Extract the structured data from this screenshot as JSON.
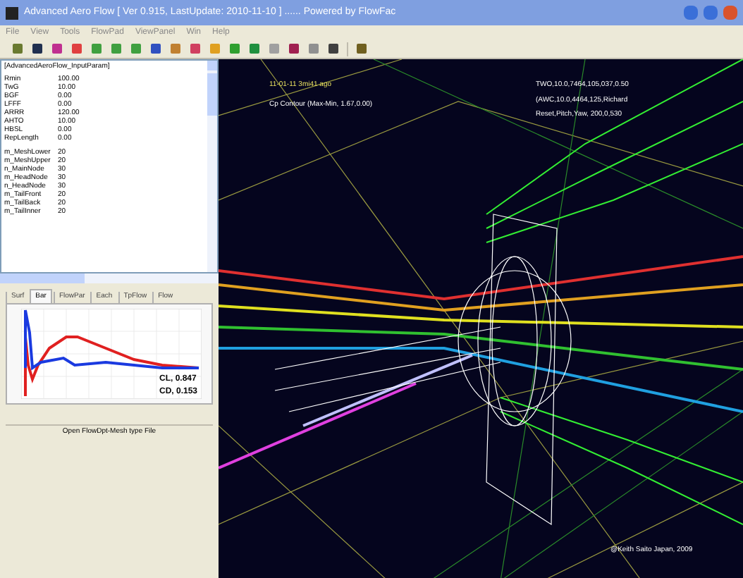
{
  "window": {
    "title": "Advanced Aero Flow [ Ver 0.915, LastUpdate: 2010-11-10 ] ...... Powered by FlowFac"
  },
  "menu": [
    "File",
    "View",
    "Tools",
    "FlowPad",
    "ViewPanel",
    "Win",
    "Help"
  ],
  "params": {
    "header": "[AdvancedAeroFlow_InputParam]",
    "groups": [
      [
        {
          "name": "Rmin",
          "value": "100.00"
        },
        {
          "name": "TwG",
          "value": "10.00"
        },
        {
          "name": "BGF",
          "value": "0.00"
        },
        {
          "name": "LFFF",
          "value": "0.00"
        },
        {
          "name": "ARRR",
          "value": "120.00"
        },
        {
          "name": "AHTO",
          "value": "10.00"
        },
        {
          "name": "HBSL",
          "value": "0.00"
        },
        {
          "name": "RepLength",
          "value": "0.00"
        }
      ],
      [
        {
          "name": "m_MeshLower",
          "value": "20"
        },
        {
          "name": "m_MeshUpper",
          "value": "20"
        },
        {
          "name": "n_MainNode",
          "value": "30"
        },
        {
          "name": "m_HeadNode",
          "value": "30"
        },
        {
          "name": "n_HeadNode",
          "value": "30"
        },
        {
          "name": "m_TailFront",
          "value": "20"
        },
        {
          "name": "m_TailBack",
          "value": "20"
        },
        {
          "name": "m_TailInner",
          "value": "20"
        }
      ]
    ]
  },
  "tabs": [
    {
      "label": "Surf",
      "selected": false
    },
    {
      "label": "Bar",
      "selected": true
    },
    {
      "label": "FlowPar",
      "selected": false
    },
    {
      "label": "Each",
      "selected": false
    },
    {
      "label": "TpFlow",
      "selected": false
    },
    {
      "label": "Flow",
      "selected": false
    }
  ],
  "chart": {
    "results": [
      "CL, 0.847",
      "CD, 0.153"
    ]
  },
  "open_button": "Open FlowDpt-Mesh type File",
  "viewport": {
    "status": "11-01-11 3mi41 ago",
    "contour": "Cp Contour (Max-Min, 1.67,0.00)",
    "info": [
      "TWO,10.0,7464,105,037,0.50",
      "(AWC,10.0,4464,125,Richard",
      "Reset,Pitch,Yaw, 200,0,530"
    ],
    "credit": "@Keith Saito Japan, 2009"
  }
}
